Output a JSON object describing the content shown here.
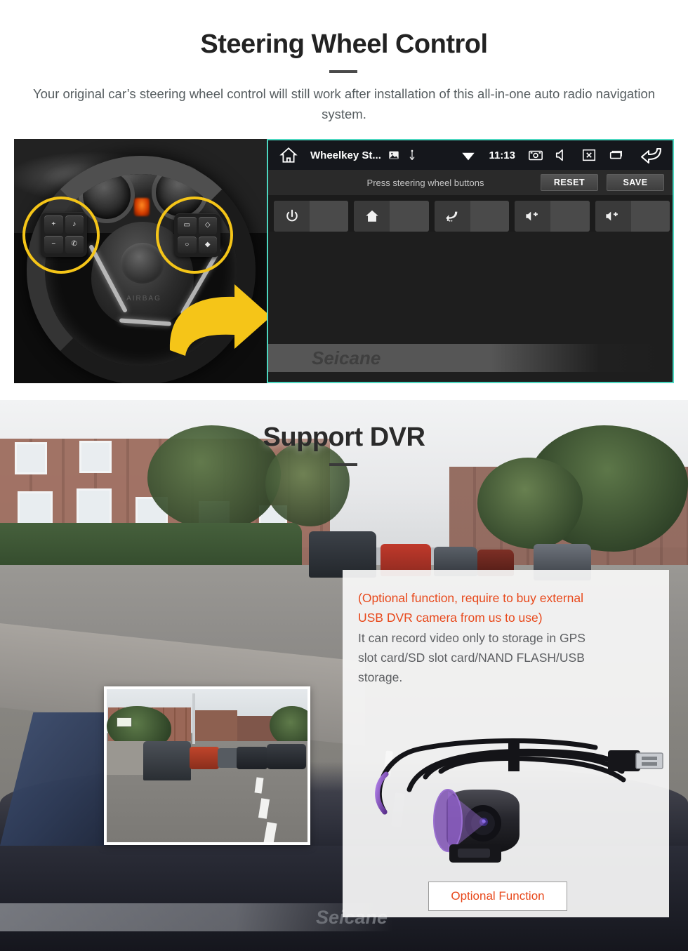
{
  "steering_section": {
    "title": "Steering Wheel Control",
    "subtitle": "Your original car’s steering wheel control will still work after installation of this all-in-one auto radio navigation system.",
    "photo_alt": "car-steering-wheel-with-highlighted-control-buttons",
    "wheel_keys": {
      "left_pad": [
        "+",
        "♪",
        "−",
        "✆"
      ],
      "right_pad": [
        "▭",
        "◇",
        "○",
        "◆"
      ],
      "airbag_text": "AIRBAG"
    },
    "android_ui": {
      "statusbar": {
        "home_icon": "home-icon",
        "app_title": "Wheelkey St...",
        "image_icon": "image-icon",
        "usb_icon": "usb-icon",
        "wifi_icon": "wifi-icon",
        "clock": "11:13",
        "screenshot_icon": "screenshot-icon",
        "mute_icon": "mute-icon",
        "display-off_icon": "display-off-icon",
        "recents_icon": "recents-icon",
        "back_icon": "back-icon"
      },
      "toolbar": {
        "hint": "Press steering wheel buttons",
        "reset_label": "RESET",
        "save_label": "SAVE"
      },
      "keys": [
        {
          "icon": "power-icon",
          "value": ""
        },
        {
          "icon": "home-icon",
          "value": ""
        },
        {
          "icon": "back-icon",
          "value": ""
        },
        {
          "icon": "volume-up-icon",
          "value": ""
        },
        {
          "icon": "volume-up-icon",
          "value": ""
        }
      ],
      "watermark": "Seicane",
      "accent_border": "#4cd7c0"
    }
  },
  "dvr_section": {
    "title": "Support DVR",
    "card": {
      "warning_line1": "(Optional function, require to buy external",
      "warning_line2": "USB DVR camera from us to use)",
      "body_line1": "It can record video only to storage in GPS",
      "body_line2": "slot card/SD slot card/NAND FLASH/USB",
      "body_line3": "storage.",
      "warning_color": "#e8491c",
      "button_label": "Optional Function",
      "product_alt": "usb-dvr-camera-with-cable"
    },
    "video_inset_alt": "dashcam-street-view-recording",
    "background_alt": "driving-view-through-windshield-on-residential-street",
    "watermark": "Seicane"
  }
}
